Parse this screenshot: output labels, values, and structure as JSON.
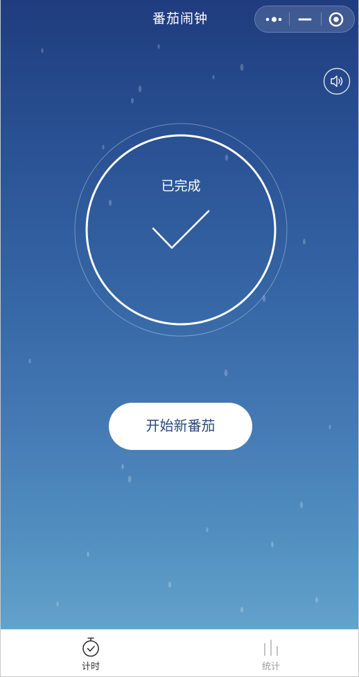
{
  "header": {
    "title": "番茄闹钟"
  },
  "capsule": {
    "more_icon": "more-dots-icon",
    "minimize_icon": "minimize-icon",
    "close_icon": "target-close-icon"
  },
  "sound_toggle": {
    "icon": "speaker-icon"
  },
  "timer": {
    "status": "已完成",
    "icon": "checkmark-icon"
  },
  "action": {
    "start_label": "开始新番茄"
  },
  "tabs": [
    {
      "label": "计时",
      "icon": "stopwatch-icon",
      "active": true
    },
    {
      "label": "统计",
      "icon": "bar-chart-icon",
      "active": false
    }
  ],
  "colors": {
    "background_top": "#1f3c7e",
    "background_bottom": "#6aa8cf",
    "button_text": "#2b4a7e",
    "tab_active": "#333333",
    "tab_inactive": "#9a9a9a"
  }
}
